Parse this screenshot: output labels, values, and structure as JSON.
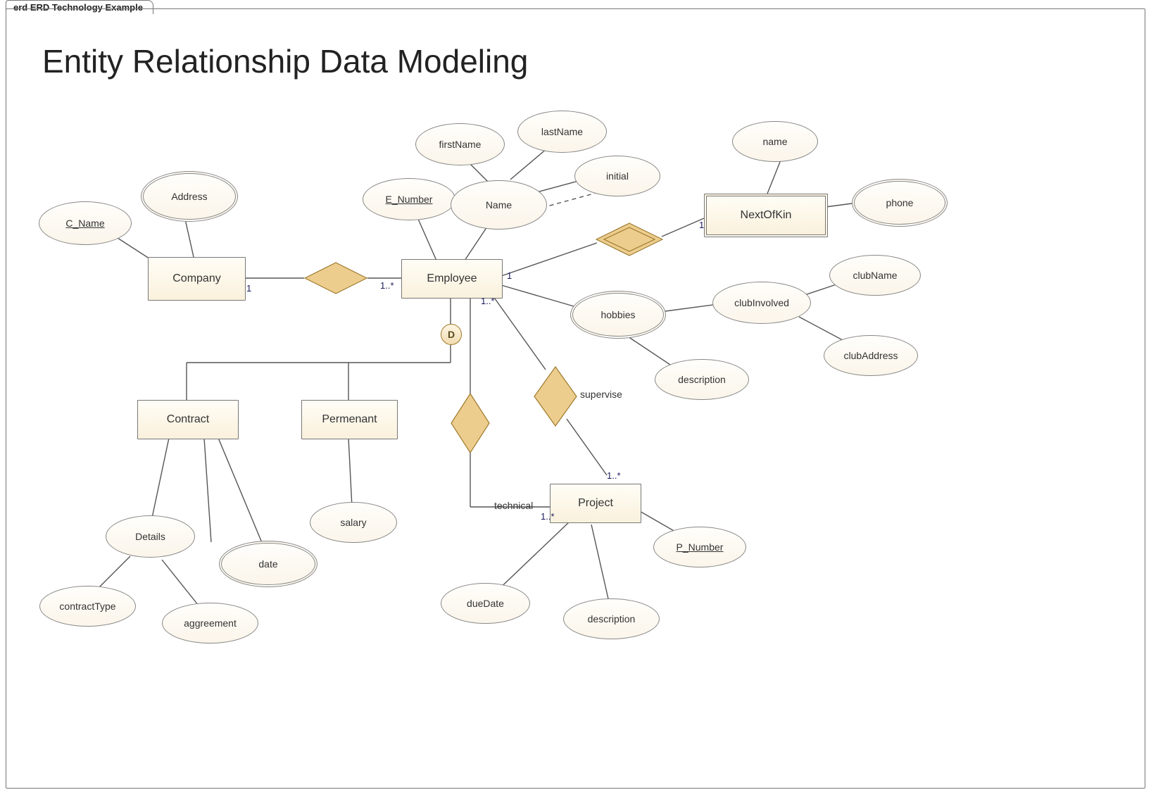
{
  "meta": {
    "tab_label": "erd ERD Technology Example",
    "title": "Entity Relationship Data Modeling"
  },
  "entities": {
    "company": "Company",
    "employee": "Employee",
    "next_of_kin": "NextOfKin",
    "contract": "Contract",
    "permanent": "Permenant",
    "project": "Project"
  },
  "attributes": {
    "c_name": "C_Name",
    "address": "Address",
    "e_number": "E_Number",
    "first_name": "firstName",
    "last_name": "lastName",
    "initial": "initial",
    "name_composite": "Name",
    "nok_name": "name",
    "nok_phone": "phone",
    "hobbies": "hobbies",
    "club_involved": "clubInvolved",
    "club_name": "clubName",
    "club_address": "clubAddress",
    "emp_description": "description",
    "details": "Details",
    "contract_type": "contractType",
    "date": "date",
    "aggreement": "aggreement",
    "salary": "salary",
    "p_number": "P_Number",
    "due_date": "dueDate",
    "proj_description": "description"
  },
  "relationships": {
    "supervise": "supervise",
    "technical": "technical"
  },
  "cardinalities": {
    "company_side": "1",
    "employee_company_side": "1..*",
    "employee_nok_side": "1",
    "nok_side": "1",
    "employee_project_side": "1..*",
    "project_supervise_side": "1..*",
    "project_technical_side": "1..*"
  },
  "disjoint_label": "D"
}
